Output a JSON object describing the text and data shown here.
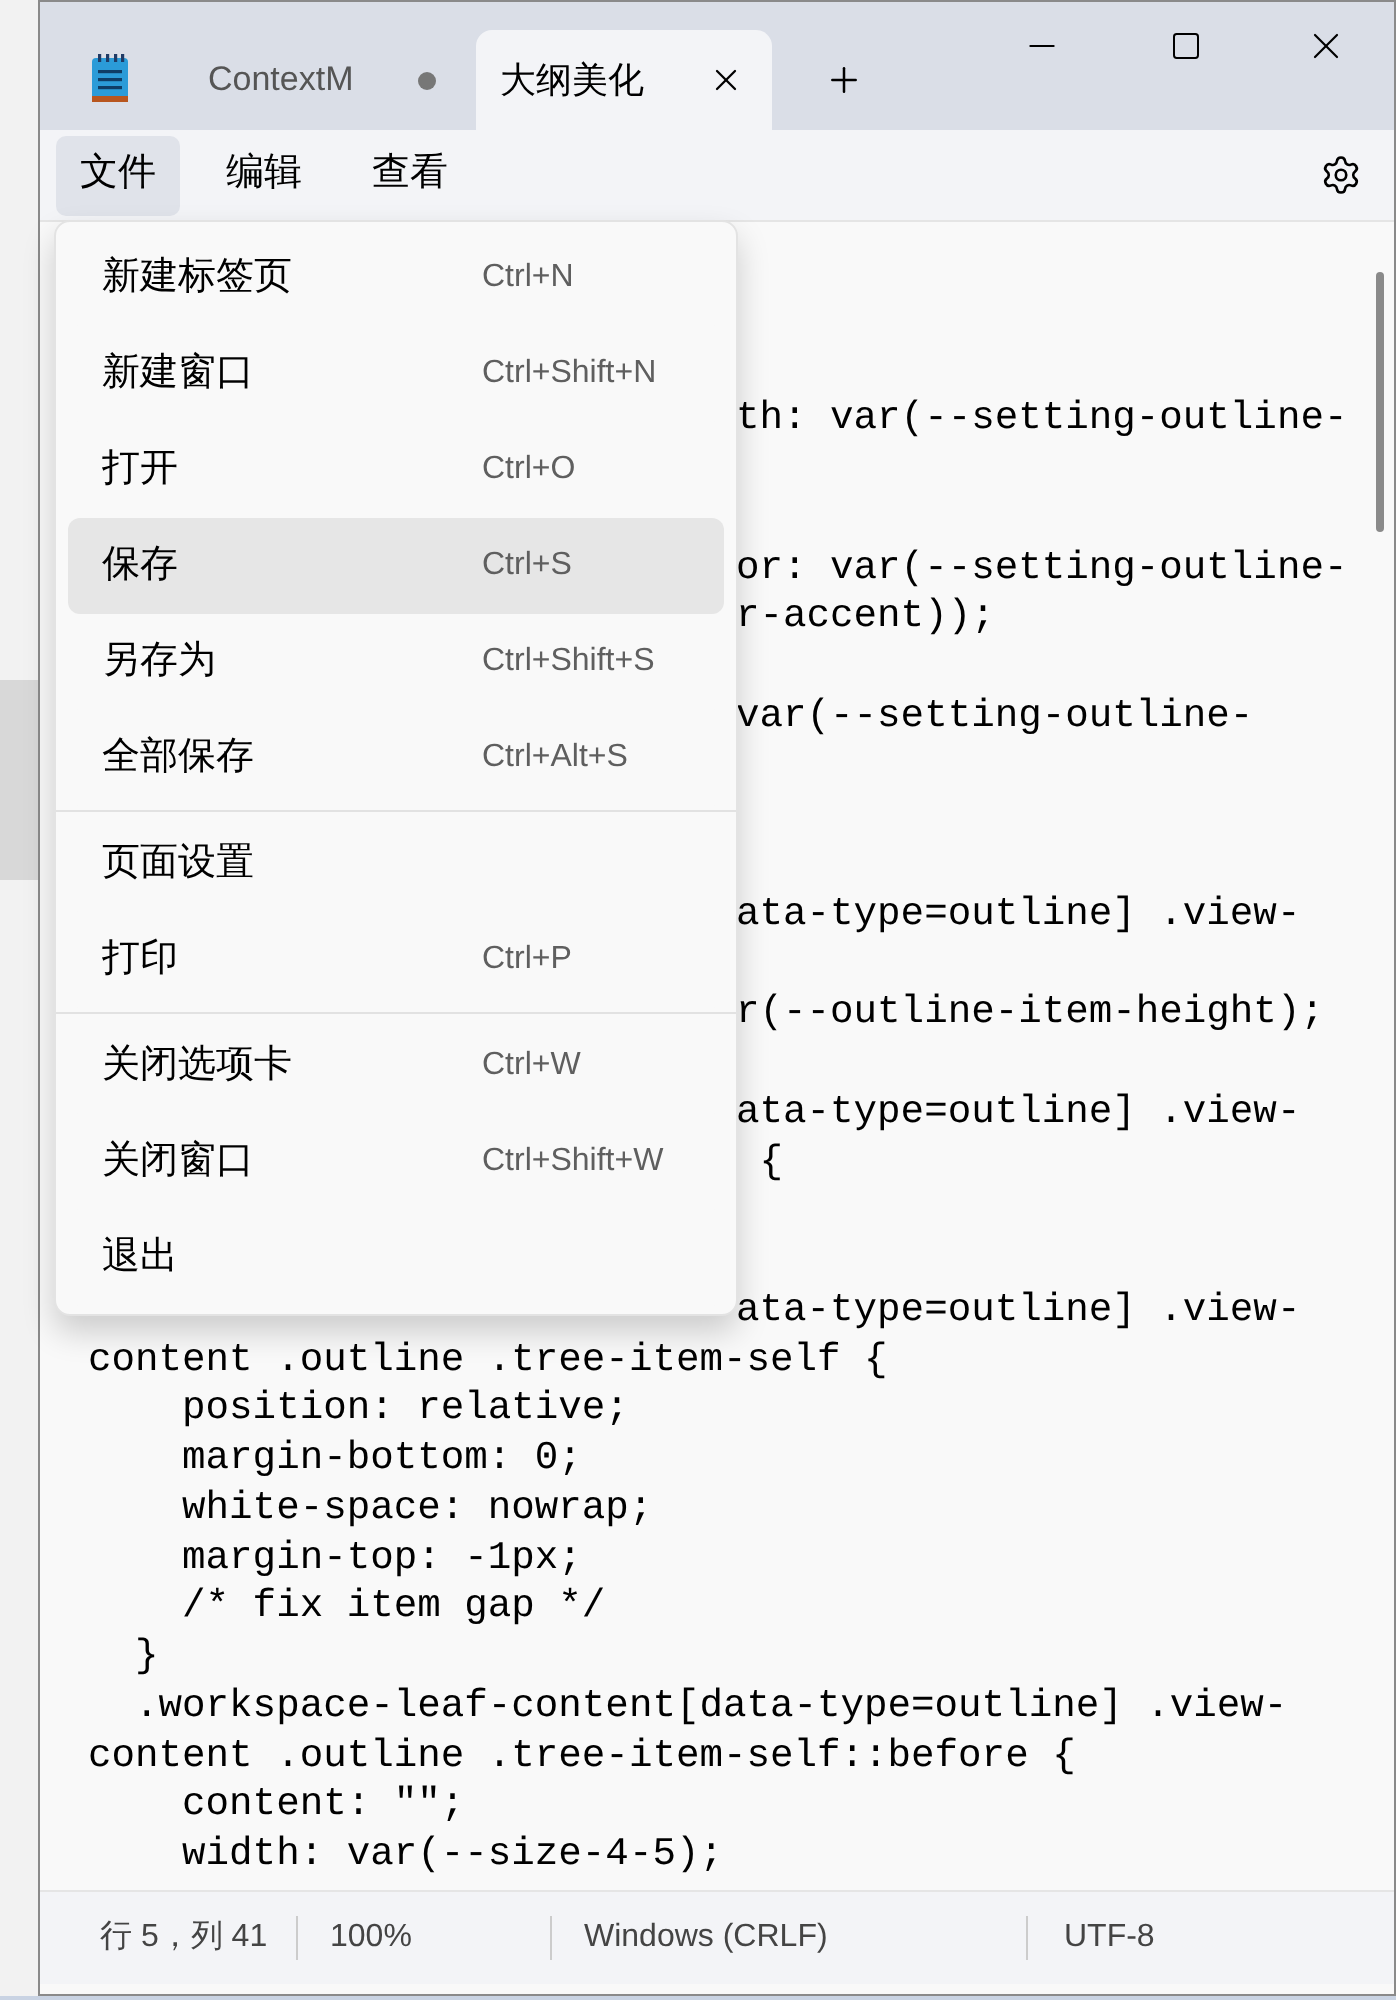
{
  "tabs": [
    {
      "label": "ContextM",
      "selected": false,
      "modified": true
    },
    {
      "label": "大纲美化",
      "selected": true,
      "modified": false
    }
  ],
  "menubar": [
    {
      "label": "文件",
      "selected": true
    },
    {
      "label": "编辑",
      "selected": false
    },
    {
      "label": "查看",
      "selected": false
    }
  ],
  "file_menu": {
    "groups": [
      [
        {
          "label": "新建标签页",
          "shortcut": "Ctrl+N",
          "selected": false
        },
        {
          "label": "新建窗口",
          "shortcut": "Ctrl+Shift+N",
          "selected": false
        },
        {
          "label": "打开",
          "shortcut": "Ctrl+O",
          "selected": false
        },
        {
          "label": "保存",
          "shortcut": "Ctrl+S",
          "selected": true
        },
        {
          "label": "另存为",
          "shortcut": "Ctrl+Shift+S",
          "selected": false
        },
        {
          "label": "全部保存",
          "shortcut": "Ctrl+Alt+S",
          "selected": false
        }
      ],
      [
        {
          "label": "页面设置",
          "selected": false
        },
        {
          "label": "打印",
          "shortcut": "Ctrl+P",
          "selected": false
        }
      ],
      [
        {
          "label": "关闭选项卡",
          "shortcut": "Ctrl+W",
          "selected": false
        },
        {
          "label": "关闭窗口",
          "shortcut": "Ctrl+Shift+W",
          "selected": false
        },
        {
          "label": "退出",
          "selected": false
        }
      ]
    ]
  },
  "editor": {
    "lines": [
      {
        "kind": "blank"
      },
      {
        "kind": "blank"
      },
      {
        "kind": "blank"
      },
      {
        "kind": "fragment",
        "text": "th: var(--setting-outline-"
      },
      {
        "kind": "blank"
      },
      {
        "kind": "blank"
      },
      {
        "kind": "fragment",
        "text": "or: var(--setting-outline-"
      },
      {
        "kind": "fragment",
        "text": "r-accent));"
      },
      {
        "kind": "blank"
      },
      {
        "kind": "fragment",
        "text": "var(--setting-outline-"
      },
      {
        "kind": "blank"
      },
      {
        "kind": "blank"
      },
      {
        "kind": "blank"
      },
      {
        "kind": "fragment",
        "text": "ata-type=outline] .view-"
      },
      {
        "kind": "blank"
      },
      {
        "kind": "fragment",
        "text": "r(--outline-item-height);"
      },
      {
        "kind": "blank"
      },
      {
        "kind": "fragment",
        "text": "ata-type=outline] .view-"
      },
      {
        "kind": "fragment",
        "text": " {"
      },
      {
        "kind": "blank"
      },
      {
        "kind": "blank"
      },
      {
        "kind": "fragment",
        "text": "ata-type=outline] .view-"
      },
      {
        "kind": "full",
        "text": "content .outline .tree-item-self {"
      },
      {
        "kind": "full",
        "text": "    position: relative;"
      },
      {
        "kind": "full",
        "text": "    margin-bottom: 0;"
      },
      {
        "kind": "full",
        "text": "    white-space: nowrap;"
      },
      {
        "kind": "full",
        "text": "    margin-top: -1px;"
      },
      {
        "kind": "full",
        "text": "    /* fix item gap */"
      },
      {
        "kind": "full",
        "text": "  }"
      },
      {
        "kind": "full",
        "text": "  .workspace-leaf-content[data-type=outline] .view-"
      },
      {
        "kind": "full",
        "text": "content .outline .tree-item-self::before {"
      },
      {
        "kind": "full",
        "text": "    content: \"\";"
      },
      {
        "kind": "full",
        "text": "    width: var(--size-4-5);"
      }
    ]
  },
  "status_bar": {
    "position": "行 5，列 41",
    "zoom": "100%",
    "line_ending": "Windows (CRLF)",
    "encoding": "UTF-8"
  }
}
